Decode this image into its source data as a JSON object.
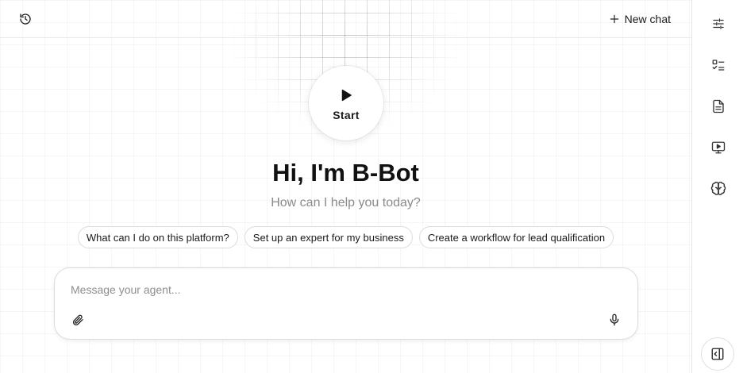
{
  "header": {
    "new_chat_label": "New chat"
  },
  "hero": {
    "start_label": "Start",
    "title": "Hi, I'm B-Bot",
    "subtitle": "How can I help you today?"
  },
  "suggestions": [
    {
      "label": "What can I do on this platform?"
    },
    {
      "label": "Set up an expert for my business"
    },
    {
      "label": "Create a workflow for lead qualification"
    }
  ],
  "composer": {
    "placeholder": "Message your agent..."
  },
  "icons": {
    "history": "history-icon",
    "plus": "plus-icon",
    "play": "play-icon",
    "attach": "paperclip-icon",
    "mic": "microphone-icon",
    "rail": [
      "sliders-icon",
      "checklist-icon",
      "document-icon",
      "video-icon",
      "brain-icon"
    ],
    "collapse": "panel-collapse-icon"
  },
  "colors": {
    "text": "#111111",
    "muted": "#8a8a8a",
    "border": "#dcdcdc"
  }
}
